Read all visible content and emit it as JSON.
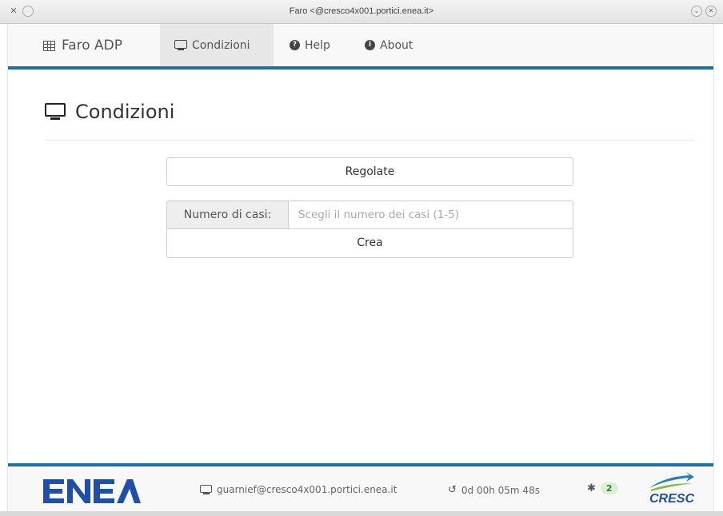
{
  "window": {
    "title": "Faro <@cresco4x001.portici.enea.it>"
  },
  "navbar": {
    "brand": "Faro ADP",
    "items": [
      {
        "label": "Condizioni",
        "icon": "monitor-icon",
        "active": true
      },
      {
        "label": "Help",
        "icon": "question-circle-icon",
        "active": false
      },
      {
        "label": "About",
        "icon": "info-circle-icon",
        "active": false
      }
    ]
  },
  "page": {
    "title": "Condizioni"
  },
  "form": {
    "regolate_label": "Regolate",
    "num_label": "Numero di casi:",
    "num_placeholder": "Scegli il numero dei casi (1-5)",
    "num_value": "",
    "crea_label": "Crea"
  },
  "footer": {
    "enea_logo": "ENEA",
    "user": "guarnief@cresco4x001.portici.enea.it",
    "uptime": "0d 00h 05m 48s",
    "bug_count": "2",
    "cresco_logo": "CRESCO"
  },
  "colors": {
    "accent": "#1a71a3",
    "logo_blue": "#1f4fa8",
    "badge_bg": "#dcefd6",
    "badge_text": "#3c763d"
  }
}
